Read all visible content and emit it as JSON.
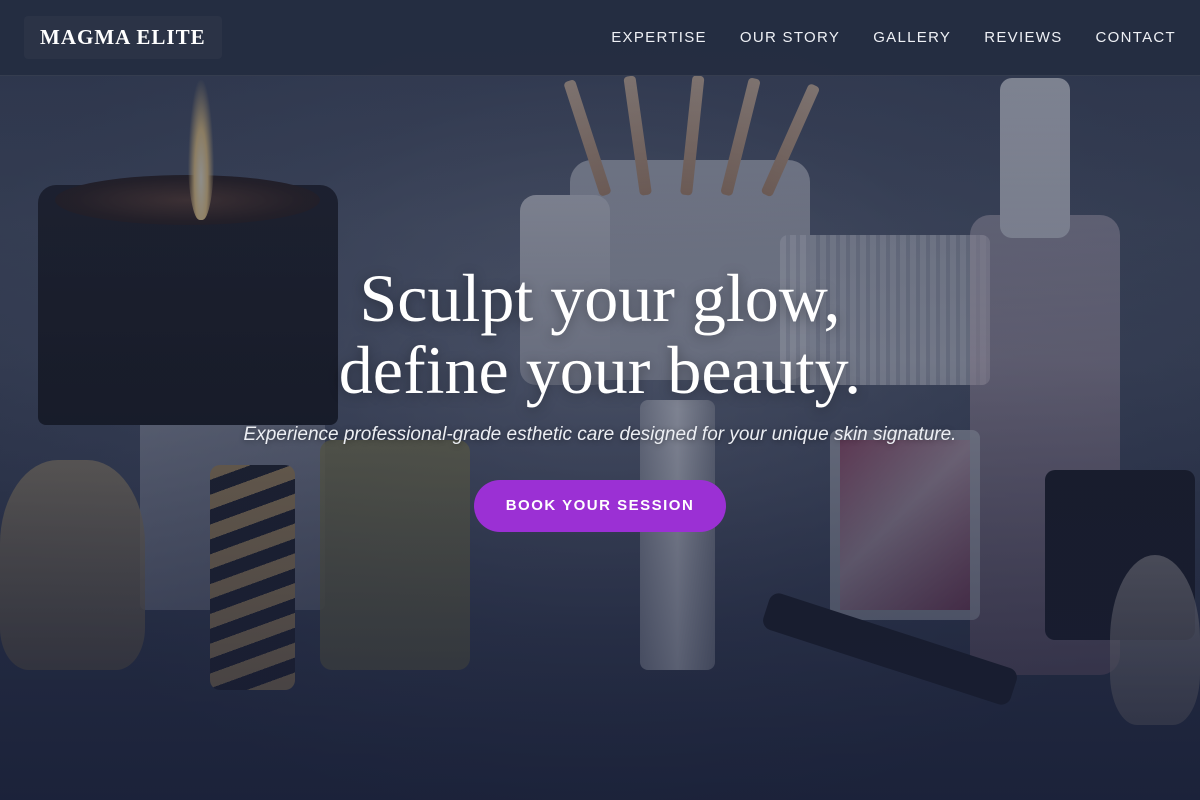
{
  "brand": {
    "logo_text": "MAGMA ELITE"
  },
  "nav": {
    "items": [
      {
        "label": "EXPERTISE"
      },
      {
        "label": "OUR STORY"
      },
      {
        "label": "GALLERY"
      },
      {
        "label": "REVIEWS"
      },
      {
        "label": "CONTACT"
      }
    ]
  },
  "hero": {
    "headline_line1": "Sculpt your glow,",
    "headline_line2": "define your beauty.",
    "subtitle": "Experience professional-grade esthetic care designed for your unique skin signature.",
    "cta_label": "BOOK YOUR SESSION",
    "background_image": "cosmetics-vanity-photo"
  },
  "colors": {
    "accent": "#9b30d4",
    "navbar_bg": "#242c40",
    "text": "#ffffff"
  }
}
